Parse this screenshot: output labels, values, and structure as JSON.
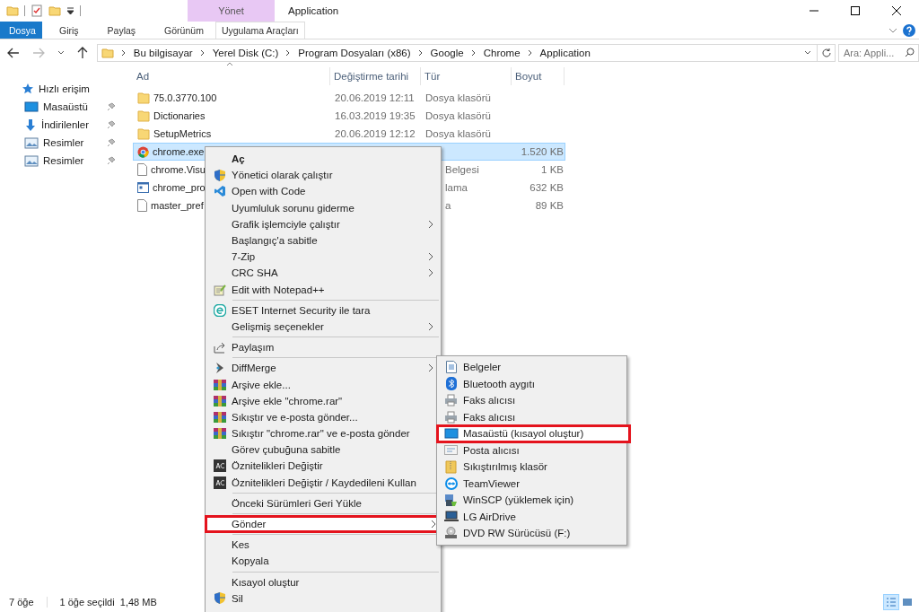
{
  "window": {
    "title": "Application",
    "context_tab_group": "Yönet"
  },
  "ribbon_tabs": [
    {
      "label": "Dosya",
      "selected": true,
      "kind": "file"
    },
    {
      "label": "Giriş",
      "selected": false,
      "kind": "tab"
    },
    {
      "label": "Paylaş",
      "selected": false,
      "kind": "tab"
    },
    {
      "label": "Görünüm",
      "selected": false,
      "kind": "tab"
    },
    {
      "label": "Uygulama Araçları",
      "selected": false,
      "kind": "context"
    }
  ],
  "breadcrumb": [
    "Bu bilgisayar",
    "Yerel Disk (C:)",
    "Program Dosyaları (x86)",
    "Google",
    "Chrome",
    "Application"
  ],
  "search": {
    "placeholder": "Ara: Appli..."
  },
  "sidebar": {
    "items": [
      {
        "label": "Hızlı erişim",
        "kind": "star",
        "pinned": false
      },
      {
        "label": "Masaüstü",
        "kind": "desktop",
        "pinned": true
      },
      {
        "label": "İndirilenler",
        "kind": "download",
        "pinned": true
      },
      {
        "label": "Resimler",
        "kind": "pictures",
        "pinned": true
      },
      {
        "label": "Resimler",
        "kind": "pictures",
        "pinned": true
      }
    ]
  },
  "table": {
    "columns": [
      "Ad",
      "Değiştirme tarihi",
      "Tür",
      "Boyut"
    ],
    "rows": [
      {
        "name": "75.0.3770.100",
        "date": "20.06.2019 12:11",
        "type": "Dosya klasörü",
        "size": "",
        "kind": "folder",
        "selected": false,
        "under_menu": false
      },
      {
        "name": "Dictionaries",
        "date": "16.03.2019 19:35",
        "type": "Dosya klasörü",
        "size": "",
        "kind": "folder",
        "selected": false,
        "under_menu": false
      },
      {
        "name": "SetupMetrics",
        "date": "20.06.2019 12:12",
        "type": "Dosya klasörü",
        "size": "",
        "kind": "folder",
        "selected": false,
        "under_menu": false
      },
      {
        "name": "chrome.exe",
        "date": "",
        "type": "",
        "size": "1.520 KB",
        "kind": "program",
        "selected": true,
        "under_menu": true
      },
      {
        "name": "chrome.Visu",
        "date": "",
        "type": "Belgesi",
        "size": "1 KB",
        "kind": "document",
        "selected": false,
        "under_menu": true
      },
      {
        "name": "chrome_pro",
        "date": "",
        "type": "lama",
        "size": "632 KB",
        "kind": "executable",
        "selected": false,
        "under_menu": true
      },
      {
        "name": "master_pref",
        "date": "",
        "type": "a",
        "size": "89 KB",
        "kind": "document",
        "selected": false,
        "under_menu": true
      }
    ]
  },
  "context_menu": {
    "items": [
      {
        "kind": "item",
        "label": "Aç",
        "default": true,
        "submenu": false,
        "selected": false
      },
      {
        "kind": "item",
        "label": "Yönetici olarak çalıştır",
        "default": false,
        "submenu": false,
        "selected": false
      },
      {
        "kind": "item",
        "label": "Open with Code",
        "default": false,
        "submenu": false,
        "selected": false
      },
      {
        "kind": "item",
        "label": "Uyumluluk sorunu giderme",
        "default": false,
        "submenu": false,
        "selected": false
      },
      {
        "kind": "item",
        "label": "Grafik işlemciyle çalıştır",
        "default": false,
        "submenu": true,
        "selected": false
      },
      {
        "kind": "item",
        "label": "Başlangıç'a sabitle",
        "default": false,
        "submenu": false,
        "selected": false
      },
      {
        "kind": "item",
        "label": "7-Zip",
        "default": false,
        "submenu": true,
        "selected": false
      },
      {
        "kind": "item",
        "label": "CRC SHA",
        "default": false,
        "submenu": true,
        "selected": false
      },
      {
        "kind": "item",
        "label": "Edit with Notepad++",
        "default": false,
        "submenu": false,
        "selected": false
      },
      {
        "kind": "separator"
      },
      {
        "kind": "item",
        "label": "ESET Internet Security ile tara",
        "default": false,
        "submenu": false,
        "selected": false
      },
      {
        "kind": "item",
        "label": "Gelişmiş seçenekler",
        "default": false,
        "submenu": true,
        "selected": false
      },
      {
        "kind": "separator"
      },
      {
        "kind": "item",
        "label": "Paylaşım",
        "default": false,
        "submenu": false,
        "selected": false
      },
      {
        "kind": "separator"
      },
      {
        "kind": "item",
        "label": "DiffMerge",
        "default": false,
        "submenu": true,
        "selected": false
      },
      {
        "kind": "item",
        "label": "Arşive ekle...",
        "default": false,
        "submenu": false,
        "selected": false
      },
      {
        "kind": "item",
        "label": "Arşive ekle \"chrome.rar\"",
        "default": false,
        "submenu": false,
        "selected": false
      },
      {
        "kind": "item",
        "label": "Sıkıştır ve e-posta gönder...",
        "default": false,
        "submenu": false,
        "selected": false
      },
      {
        "kind": "item",
        "label": "Sıkıştır \"chrome.rar\" ve e-posta gönder",
        "default": false,
        "submenu": false,
        "selected": false
      },
      {
        "kind": "item",
        "label": "Görev çubuğuna sabitle",
        "default": false,
        "submenu": false,
        "selected": false
      },
      {
        "kind": "item",
        "label": "Öznitelikleri Değiştir",
        "default": false,
        "submenu": false,
        "selected": false
      },
      {
        "kind": "item",
        "label": "Öznitelikleri Değiştir / Kaydedileni Kullan",
        "default": false,
        "submenu": false,
        "selected": false
      },
      {
        "kind": "separator"
      },
      {
        "kind": "item",
        "label": "Önceki Sürümleri Geri Yükle",
        "default": false,
        "submenu": false,
        "selected": false
      },
      {
        "kind": "separator"
      },
      {
        "kind": "item",
        "label": "Gönder",
        "default": false,
        "submenu": true,
        "selected": true
      },
      {
        "kind": "separator"
      },
      {
        "kind": "item",
        "label": "Kes",
        "default": false,
        "submenu": false,
        "selected": false
      },
      {
        "kind": "item",
        "label": "Kopyala",
        "default": false,
        "submenu": false,
        "selected": false
      },
      {
        "kind": "separator"
      },
      {
        "kind": "item",
        "label": "Kısayol oluştur",
        "default": false,
        "submenu": false,
        "selected": false
      },
      {
        "kind": "item",
        "label": "Sil",
        "default": false,
        "submenu": false,
        "selected": false
      }
    ]
  },
  "send_to_menu": {
    "items": [
      {
        "label": "Belgeler",
        "selected": false
      },
      {
        "label": "Bluetooth aygıtı",
        "selected": false
      },
      {
        "label": "Faks alıcısı",
        "selected": false
      },
      {
        "label": "Faks alıcısı",
        "selected": false
      },
      {
        "label": "Masaüstü (kısayol oluştur)",
        "selected": true
      },
      {
        "label": "Posta alıcısı",
        "selected": false
      },
      {
        "label": "Sıkıştırılmış klasör",
        "selected": false
      },
      {
        "label": "TeamViewer",
        "selected": false
      },
      {
        "label": "WinSCP (yüklemek için)",
        "selected": false
      },
      {
        "label": "LG AirDrive",
        "selected": false
      },
      {
        "label": "DVD RW Sürücüsü (F:)",
        "selected": false
      }
    ]
  },
  "status_bar": {
    "item_count": "7 öğe",
    "selection": "1 öğe seçildi  1,48 MB"
  }
}
